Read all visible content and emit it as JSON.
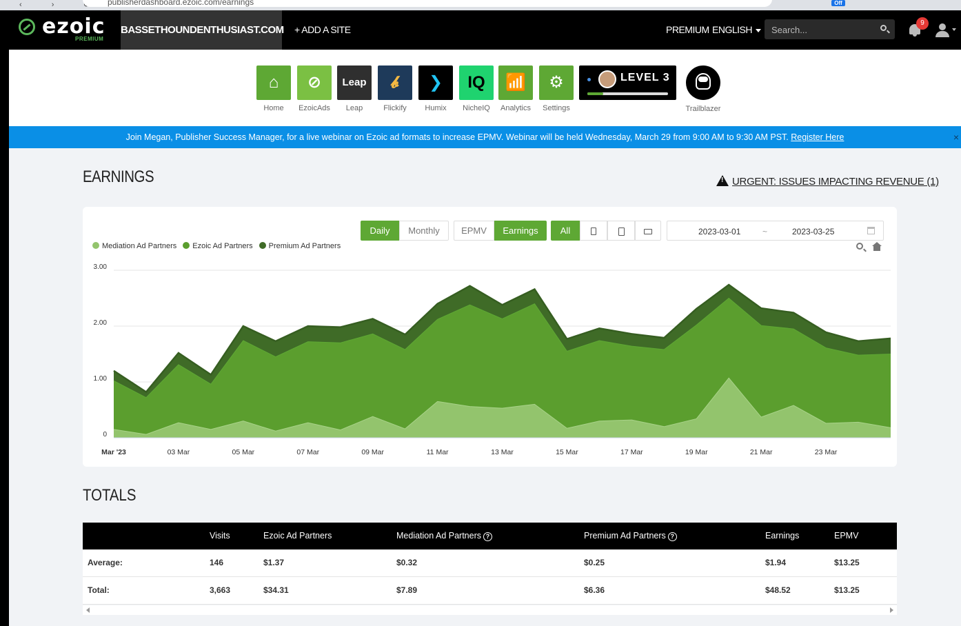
{
  "browser": {
    "url_fragment": "publisherdashboard.ezoic.com/earnings",
    "ext_badge": "Off"
  },
  "nav": {
    "logo_word": "ezoic",
    "logo_tier": "PREMIUM",
    "site": "BASSETHOUNDENTHUSIAST.COM",
    "add_site": "+ ADD A SITE",
    "premium": "PREMIUM",
    "language": "ENGLISH",
    "search_placeholder": "Search...",
    "notifications": "9"
  },
  "apps": [
    {
      "label": "Home",
      "icon": "home-icon",
      "glyph": "⌂",
      "color": "#5ea834"
    },
    {
      "label": "EzoicAds",
      "icon": "ezoicads-icon",
      "glyph": "⊘",
      "color": "#7bc043"
    },
    {
      "label": "Leap",
      "icon": "leap-icon",
      "glyph": "Leap",
      "color": "#2f2f2f"
    },
    {
      "label": "Flickify",
      "icon": "flickify-icon",
      "glyph": "𝓫",
      "color": "#1e3a5a"
    },
    {
      "label": "Humix",
      "icon": "humix-icon",
      "glyph": "❯",
      "color": "#000000"
    },
    {
      "label": "NicheIQ",
      "icon": "nicheiq-icon",
      "glyph": "IQ",
      "color": "#1fd36f"
    },
    {
      "label": "Analytics",
      "icon": "analytics-icon",
      "glyph": "📶",
      "color": "#5ea834"
    },
    {
      "label": "Settings",
      "icon": "gear-icon",
      "glyph": "⚙",
      "color": "#5ea834"
    }
  ],
  "level": {
    "text": "LEVEL 3",
    "progress": 0.2
  },
  "trailblazer": {
    "label": "Trailblazer"
  },
  "banner": {
    "text": "Join Megan, Publisher Success Manager, for a live webinar on Ezoic ad formats to increase EPMV. Webinar will be held Wednesday, March 29 from 9:00 AM to 9:30 AM PST.",
    "link": "Register Here",
    "close": "×"
  },
  "earnings": {
    "title": "EARNINGS",
    "urgent": "URGENT: ISSUES IMPACTING REVENUE (1)",
    "toggles": {
      "daily": "Daily",
      "monthly": "Monthly",
      "epmv": "EPMV",
      "earnings": "Earnings",
      "all": "All"
    },
    "date_from": "2023-03-01",
    "date_sep": "~",
    "date_to": "2023-03-25"
  },
  "colors": {
    "brand_green": "#5ea834",
    "mediation": "#93c46d",
    "ezoic": "#5b9e2e",
    "premium": "#3f6b27",
    "banner_blue": "#0a8fe6"
  },
  "chart_data": {
    "type": "area",
    "stacked": true,
    "x": [
      "2023-03-01",
      "2023-03-02",
      "2023-03-03",
      "2023-03-04",
      "2023-03-05",
      "2023-03-06",
      "2023-03-07",
      "2023-03-08",
      "2023-03-09",
      "2023-03-10",
      "2023-03-11",
      "2023-03-12",
      "2023-03-13",
      "2023-03-14",
      "2023-03-15",
      "2023-03-16",
      "2023-03-17",
      "2023-03-18",
      "2023-03-19",
      "2023-03-20",
      "2023-03-21",
      "2023-03-22",
      "2023-03-23",
      "2023-03-24",
      "2023-03-25"
    ],
    "tick_labels": [
      "Mar '23",
      "03 Mar",
      "05 Mar",
      "07 Mar",
      "09 Mar",
      "11 Mar",
      "13 Mar",
      "15 Mar",
      "17 Mar",
      "19 Mar",
      "21 Mar",
      "23 Mar"
    ],
    "yticks": [
      "3.00",
      "2.00",
      "1.00",
      "0"
    ],
    "ylim": [
      0,
      3
    ],
    "legend_position": "top-left",
    "grid": true,
    "series": [
      {
        "name": "Mediation Ad Partners",
        "values": [
          0.15,
          0.06,
          0.27,
          0.15,
          0.3,
          0.12,
          0.27,
          0.14,
          0.38,
          0.16,
          0.65,
          0.56,
          0.53,
          0.6,
          0.17,
          0.3,
          0.32,
          0.2,
          0.34,
          1.07,
          0.37,
          0.58,
          0.26,
          0.28,
          0.18
        ]
      },
      {
        "name": "Ezoic Ad Partners",
        "values": [
          0.87,
          0.66,
          1.04,
          0.81,
          1.44,
          1.33,
          1.45,
          1.56,
          1.48,
          1.42,
          1.47,
          1.82,
          1.6,
          1.8,
          1.38,
          1.44,
          1.32,
          1.38,
          1.68,
          1.43,
          1.64,
          1.37,
          1.35,
          1.2,
          1.32
        ]
      },
      {
        "name": "Premium Ad Partners",
        "values": [
          0.18,
          0.1,
          0.21,
          0.17,
          0.26,
          0.28,
          0.28,
          0.28,
          0.27,
          0.27,
          0.28,
          0.34,
          0.25,
          0.26,
          0.22,
          0.22,
          0.22,
          0.21,
          0.29,
          0.24,
          0.31,
          0.29,
          0.28,
          0.25,
          0.28
        ]
      }
    ]
  },
  "totals": {
    "title": "TOTALS",
    "headers": [
      "",
      "Visits",
      "Ezoic Ad Partners",
      "Mediation Ad Partners",
      "Premium Ad Partners",
      "Earnings",
      "EPMV"
    ],
    "rows": [
      [
        "Average:",
        "146",
        "$1.37",
        "$0.32",
        "$0.25",
        "$1.94",
        "$13.25"
      ],
      [
        "Total:",
        "3,663",
        "$34.31",
        "$7.89",
        "$6.36",
        "$48.52",
        "$13.25"
      ]
    ]
  }
}
